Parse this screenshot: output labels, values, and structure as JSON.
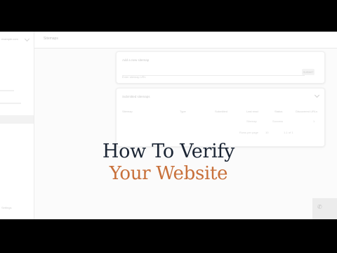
{
  "app": {
    "property_selector": "example.com",
    "page_title": "Sitemaps"
  },
  "sidebar": {
    "footer": "Settings"
  },
  "add_sitemap": {
    "title": "Add a new sitemap",
    "placeholder": "Enter sitemap URL",
    "submit_label": "SUBMIT"
  },
  "submitted": {
    "title": "Submitted sitemaps",
    "columns": [
      "Sitemap",
      "Type",
      "Submitted",
      "Last read",
      "Status",
      "Discovered URLs"
    ],
    "rows": [
      [
        "",
        "",
        "",
        "Sitemap",
        "Success",
        "1"
      ],
      [
        "Rows per page",
        "10",
        "1-1 of 1",
        "",
        "",
        ""
      ]
    ]
  },
  "overlay": {
    "line1": "How To Verify",
    "line2": "Your Website",
    "colors": {
      "line1": "#1a2433",
      "line2": "#c8703a"
    }
  },
  "toast": {
    "icon": "phone-icon"
  }
}
